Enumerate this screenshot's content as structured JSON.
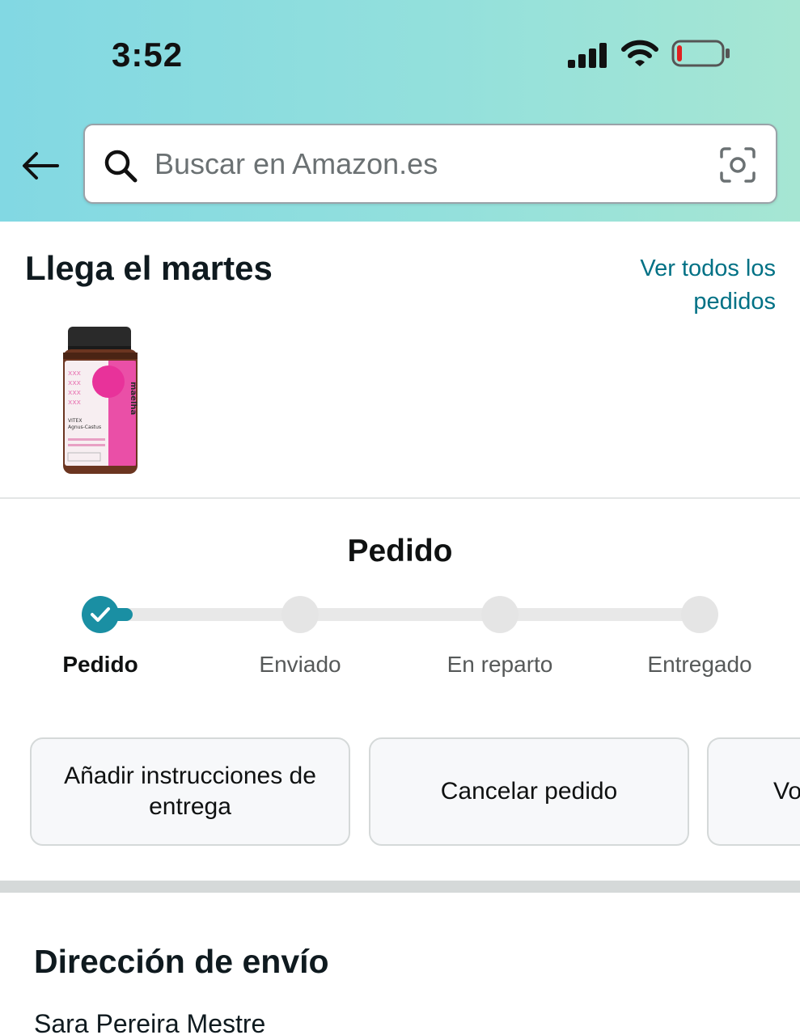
{
  "status_bar": {
    "time": "3:52",
    "icons": [
      "signal-icon",
      "wifi-icon",
      "battery-low-icon"
    ],
    "battery_color": "#e02020"
  },
  "search": {
    "placeholder": "Buscar en Amazon.es",
    "value": ""
  },
  "arrival": {
    "title": "Llega el martes",
    "view_all_line1": "Ver todos los",
    "view_all_line2": "pedidos",
    "product_brand": "maelha",
    "product_name": "VITEX Agnus-Castus"
  },
  "tracker": {
    "title": "Pedido",
    "progress": 0,
    "steps": [
      {
        "label": "Pedido",
        "done": true
      },
      {
        "label": "Enviado",
        "done": false
      },
      {
        "label": "En reparto",
        "done": false
      },
      {
        "label": "Entregado",
        "done": false
      }
    ]
  },
  "actions": {
    "add_instructions": "Añadir instrucciones de entrega",
    "cancel": "Cancelar pedido",
    "partial_label": "Vo"
  },
  "shipping": {
    "title": "Dirección de envío",
    "name": "Sara Pereira Mestre"
  },
  "colors": {
    "accent": "#1a8fa3",
    "link": "#007185",
    "header_gradient_start": "#82d8e3",
    "header_gradient_end": "#a6e6d3"
  }
}
